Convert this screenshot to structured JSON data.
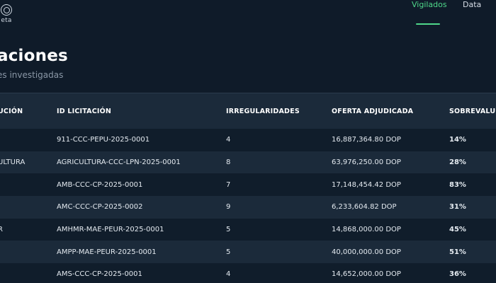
{
  "header": {
    "brand_label": "eta",
    "nav": [
      {
        "label": "Vigilados",
        "active": true
      },
      {
        "label": "Data",
        "active": false
      }
    ]
  },
  "page": {
    "title": "aciones",
    "subtitle": "es investigadas"
  },
  "table": {
    "columns": [
      "UCIÓN",
      "ID LICITACIÓN",
      "IRREGULARIDADES",
      "OFERTA ADJUDICADA",
      "SOBREVALU"
    ],
    "rows": [
      {
        "institucion": "",
        "id": "911-CCC-PEPU-2025-0001",
        "irregularidades": "4",
        "oferta": "16,887,364.80 DOP",
        "sobrevaluacion": "14%"
      },
      {
        "institucion": "ULTURA",
        "id": "AGRICULTURA-CCC-LPN-2025-0001",
        "irregularidades": "8",
        "oferta": "63,976,250.00 DOP",
        "sobrevaluacion": "28%"
      },
      {
        "institucion": "",
        "id": "AMB-CCC-CP-2025-0001",
        "irregularidades": "7",
        "oferta": "17,148,454.42 DOP",
        "sobrevaluacion": "83%"
      },
      {
        "institucion": "",
        "id": "AMC-CCC-CP-2025-0002",
        "irregularidades": "9",
        "oferta": "6,233,604.82 DOP",
        "sobrevaluacion": "31%"
      },
      {
        "institucion": "R",
        "id": "AMHMR-MAE-PEUR-2025-0001",
        "irregularidades": "5",
        "oferta": "14,868,000.00 DOP",
        "sobrevaluacion": "45%"
      },
      {
        "institucion": "",
        "id": "AMPP-MAE-PEUR-2025-0001",
        "irregularidades": "5",
        "oferta": "40,000,000.00 DOP",
        "sobrevaluacion": "51%"
      },
      {
        "institucion": "",
        "id": "AMS-CCC-CP-2025-0001",
        "irregularidades": "4",
        "oferta": "14,652,000.00 DOP",
        "sobrevaluacion": "36%"
      }
    ]
  }
}
